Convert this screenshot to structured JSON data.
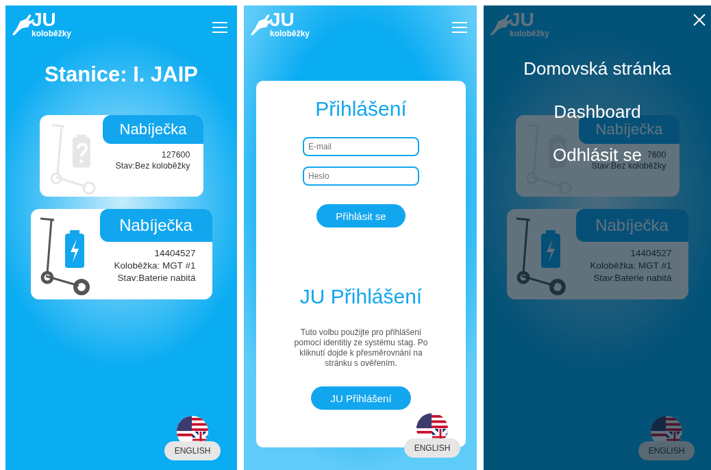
{
  "screens": [
    {
      "kind": "station",
      "logo": {
        "title": "JU",
        "subtitle": "koloběžky"
      },
      "title": "Stanice: I. JAIP",
      "chargers": [
        {
          "kind": "empty",
          "title": "Nabíječka",
          "lines": [
            "127600",
            "Stav:Bez koloběžky"
          ]
        },
        {
          "kind": "charged",
          "title": "Nabíječka",
          "lines": [
            "14404527",
            "Koloběžka: MGT #1",
            "Stav:Baterie nabitá"
          ]
        }
      ],
      "language_button": "ENGLISH"
    },
    {
      "kind": "login",
      "logo": {
        "title": "JU",
        "subtitle": "koloběžky"
      },
      "title": "Přihlášení",
      "fields": [
        {
          "placeholder": "E-mail"
        },
        {
          "placeholder": "Heslo"
        }
      ],
      "submit_button": "Přihlásit se",
      "sso_title": "JU Přihlášení",
      "sso_text": "Tuto volbu použijte pro přihlášení pomocí identitiy ze systému stag. Po kliknutí dojde k přesměrovnání na stránku s ověřením.",
      "sso_button": "JU Přihlášení",
      "language_button": "ENGLISH"
    },
    {
      "kind": "station",
      "logo": {
        "title": "JU",
        "subtitle": "koloběžky"
      },
      "chargers": [
        {
          "kind": "empty",
          "title": "Nabíječka",
          "lines": [
            "7600",
            "Stav:Bez koloběžky"
          ]
        },
        {
          "kind": "charged",
          "title": "Nabíječka",
          "lines": [
            "14404527",
            "Koloběžka: MGT #1",
            "Stav:Baterie nabitá"
          ]
        }
      ],
      "language_button": "ENGLISH",
      "menu": {
        "items": [
          "Domovská stránka",
          "Dashboard",
          "Odhlásit se"
        ]
      }
    }
  ]
}
